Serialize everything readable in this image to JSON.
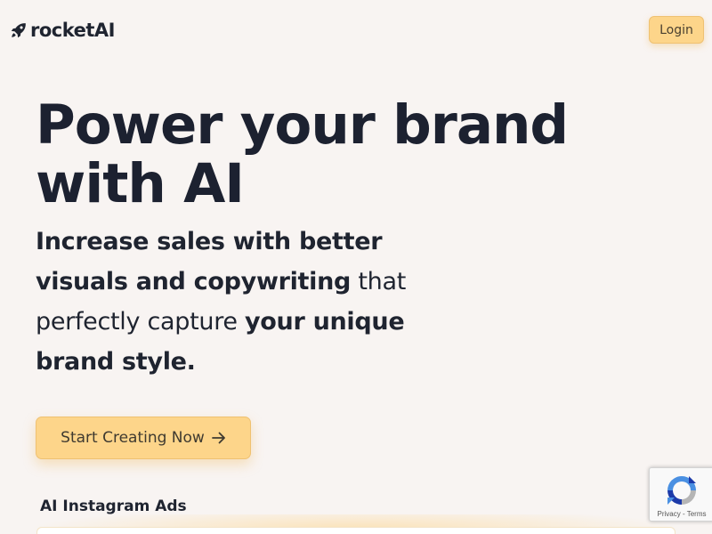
{
  "header": {
    "brand": "rocketAI",
    "brand_icon": "rocket-icon",
    "login_label": "Login"
  },
  "hero": {
    "title_line1": "Power your brand",
    "title_line2": "with AI",
    "subtitle": {
      "part1": "Increase sales with better",
      "part2": "visuals and copywriting",
      "part3": " that",
      "part4": "perfectly capture ",
      "part5": "your unique",
      "part6": "brand style."
    },
    "cta_label": "Start Creating Now",
    "cta_icon": "arrow-right-icon"
  },
  "section": {
    "label": "AI Instagram Ads"
  },
  "recaptcha": {
    "privacy": "Privacy",
    "separator": " - ",
    "terms": "Terms"
  },
  "colors": {
    "background": "#f8f4f2",
    "accent": "#fdd58a",
    "text": "#1f2430"
  }
}
